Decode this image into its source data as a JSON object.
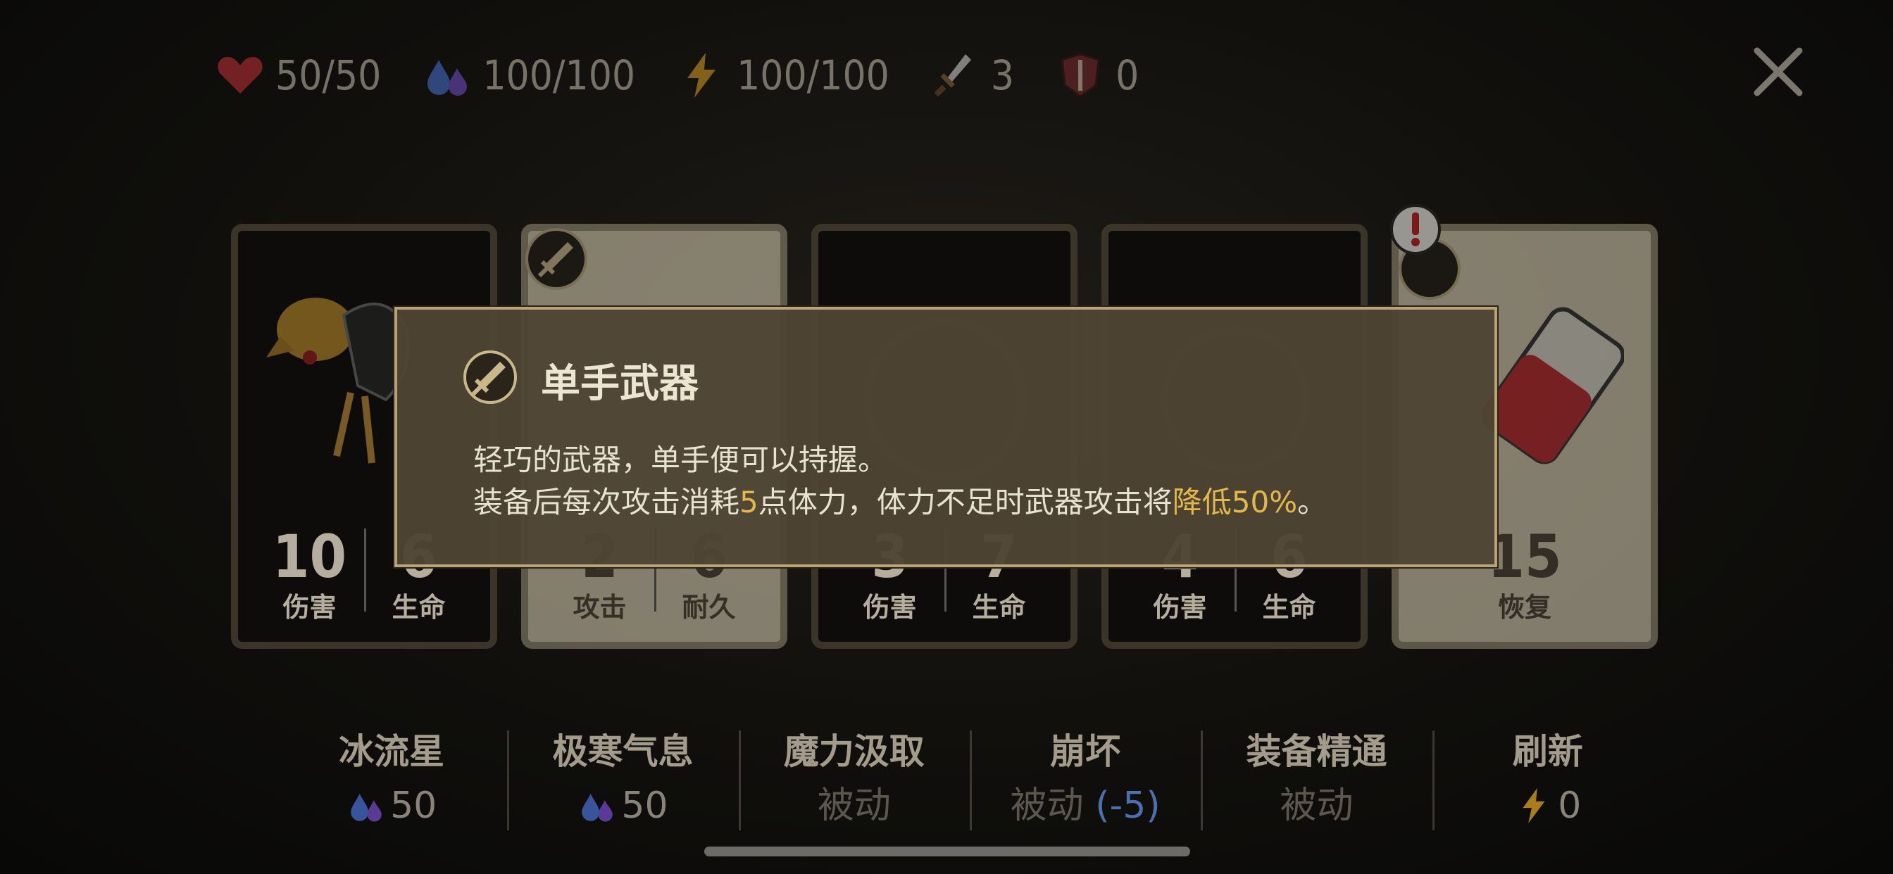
{
  "stats": {
    "health": "50/50",
    "mana": "100/100",
    "energy": "100/100",
    "attack": "3",
    "armor": "0"
  },
  "cards": [
    {
      "style": "dark",
      "art": "skeleton-vulture",
      "stats": [
        {
          "value": "10",
          "label": "伤害"
        },
        {
          "value": "6",
          "label": "生命"
        }
      ]
    },
    {
      "style": "light",
      "art": "one-hand-sword",
      "stats": [
        {
          "value": "2",
          "label": "攻击"
        },
        {
          "value": "6",
          "label": "耐久"
        }
      ]
    },
    {
      "style": "dark",
      "art": "dark-seal",
      "stats": [
        {
          "value": "3",
          "label": "伤害"
        },
        {
          "value": "7",
          "label": "生命"
        }
      ]
    },
    {
      "style": "dark",
      "art": "dark-seal",
      "stats": [
        {
          "value": "4",
          "label": "伤害"
        },
        {
          "value": "6",
          "label": "生命"
        }
      ]
    },
    {
      "style": "light",
      "art": "health-potion",
      "stats": [
        {
          "value": "15",
          "label": "恢复"
        }
      ]
    }
  ],
  "tooltip": {
    "icon": "one-hand-weapon-icon",
    "title": "单手武器",
    "line1": "轻巧的武器，单手便可以持握。",
    "line2_a": "装备后每次攻击消耗",
    "line2_hl1": "5",
    "line2_b": "点体力，体力不足时武器攻击将",
    "line2_hl2": "降低50%",
    "line2_c": "。"
  },
  "skills": [
    {
      "name": "冰流星",
      "cost": "50",
      "cost_icon": "mana-drops-icon"
    },
    {
      "name": "极寒气息",
      "cost": "50",
      "cost_icon": "mana-drops-icon"
    },
    {
      "name": "魔力汲取",
      "cost": "被动"
    },
    {
      "name": "崩坏",
      "cost": "被动",
      "cost_extra": "(-5)"
    },
    {
      "name": "装备精通",
      "cost": "被动"
    },
    {
      "name": "刷新",
      "cost": "0",
      "cost_icon": "energy-bolt-icon"
    }
  ],
  "colors": {
    "highlight": "#e2b84a",
    "tooltip_border": "#b9a478",
    "negative_blue": "#4b6fb0"
  }
}
